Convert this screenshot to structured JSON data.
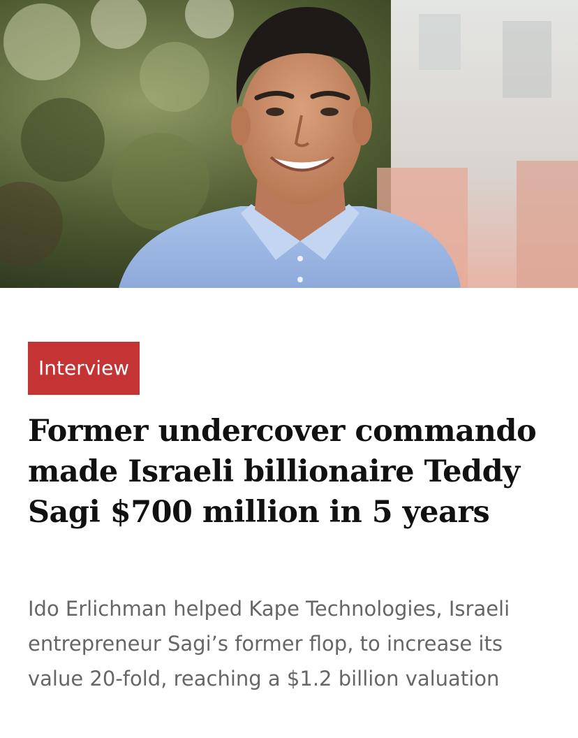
{
  "hero": {
    "image": "portrait-photo"
  },
  "article": {
    "category": "Interview",
    "headline": "Former undercover commando made Israeli billionaire Teddy Sagi $700 million in 5 years",
    "subtitle": "Ido Erlichman helped Kape Technologies, Israeli entrepreneur Sagi’s former flop, to increase its value 20-fold, reaching a $1.2 billion valuation"
  },
  "colors": {
    "tag_background": "#c43434",
    "headline_text": "#111111",
    "subtitle_text": "#666666"
  }
}
